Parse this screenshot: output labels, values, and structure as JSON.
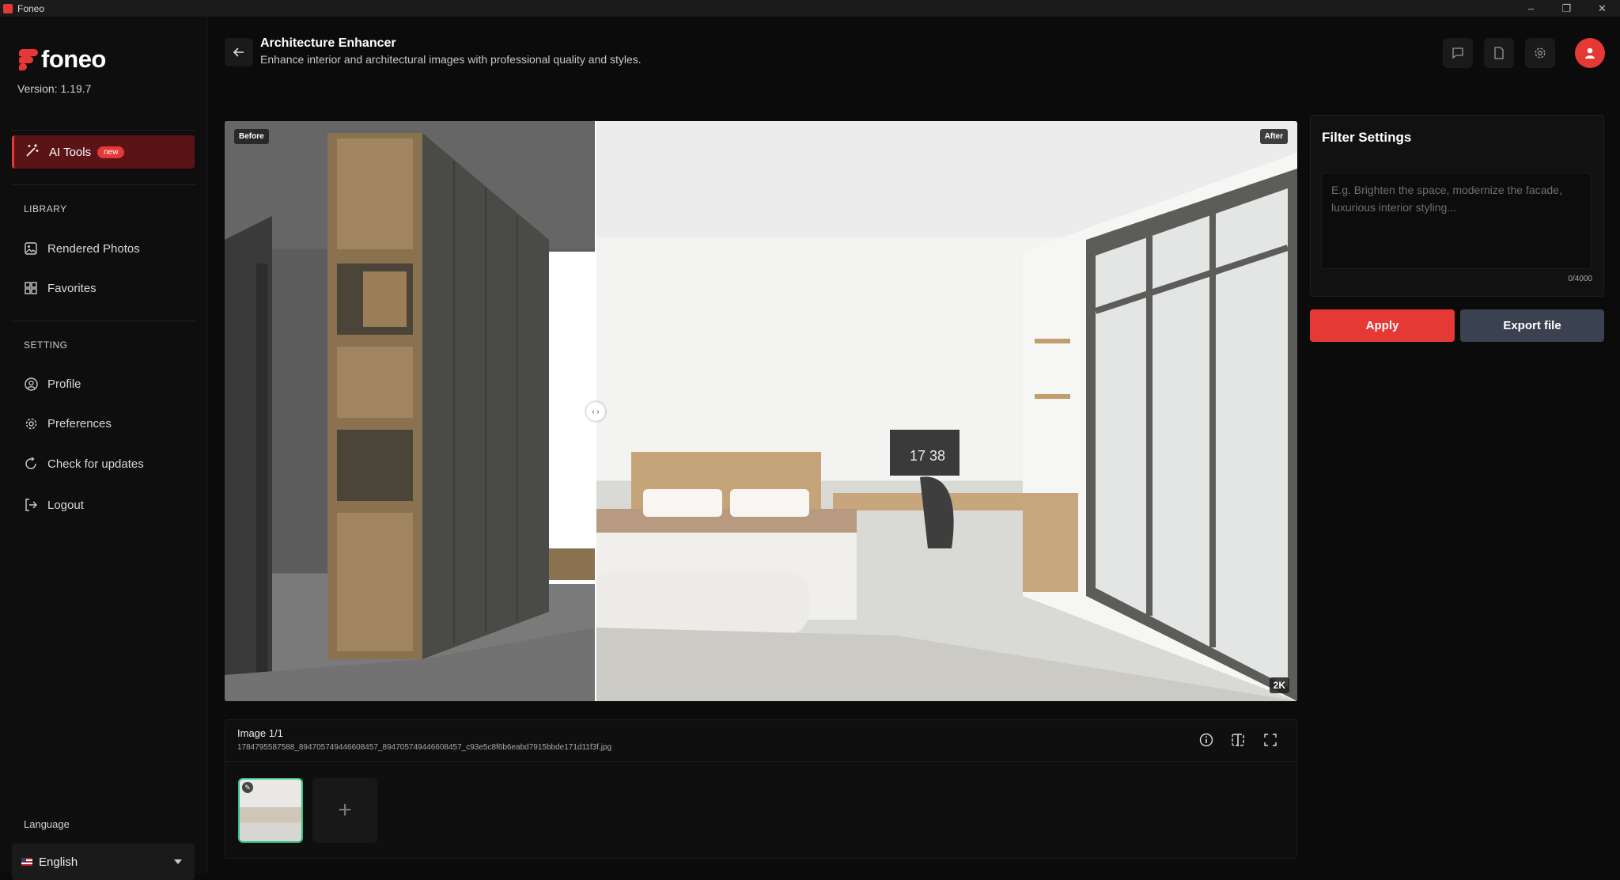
{
  "window": {
    "title": "Foneo",
    "minimize": "–",
    "restore": "❐",
    "close": "✕"
  },
  "sidebar": {
    "brand": "foneo",
    "version": "Version: 1.19.7",
    "ai_tools": {
      "label": "AI Tools",
      "badge": "new"
    },
    "library": {
      "heading": "LIBRARY",
      "items": [
        {
          "label": "Rendered Photos",
          "icon": "image-icon"
        },
        {
          "label": "Favorites",
          "icon": "grid-icon"
        }
      ]
    },
    "setting": {
      "heading": "SETTING",
      "items": [
        {
          "label": "Profile",
          "icon": "user-circle-icon"
        },
        {
          "label": "Preferences",
          "icon": "gear-icon"
        },
        {
          "label": "Check for updates",
          "icon": "refresh-icon"
        },
        {
          "label": "Logout",
          "icon": "logout-icon"
        }
      ]
    },
    "language": {
      "label": "Language",
      "value": "English"
    }
  },
  "header": {
    "title": "Architecture Enhancer",
    "subtitle": "Enhance interior and architectural images with professional quality and styles."
  },
  "viewer": {
    "before_label": "Before",
    "after_label": "After",
    "resolution": "2K",
    "handle": "‹ ›",
    "clock": "17 38"
  },
  "filter": {
    "title": "Filter Settings",
    "placeholder": "E.g. Brighten the space, modernize the facade, luxurious interior styling...",
    "count": "0/4000",
    "apply": "Apply",
    "export": "Export file"
  },
  "gallery": {
    "count": "Image 1/1",
    "filename": "1784795587588_894705749446608457_894705749446608457_c93e5c8f6b6eabd7915bbde171d11f3f.jpg",
    "add": "+"
  },
  "colors": {
    "accent": "#e53935",
    "selected": "#34c28a",
    "export": "#3a4150"
  }
}
